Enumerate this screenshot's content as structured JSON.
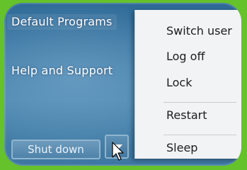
{
  "start_menu": {
    "default_programs": "Default Programs",
    "help_support": "Help and Support",
    "shutdown_button": "Shut down"
  },
  "power_menu": {
    "items": [
      "Switch user",
      "Log off",
      "Lock",
      "Restart",
      "Sleep"
    ]
  }
}
